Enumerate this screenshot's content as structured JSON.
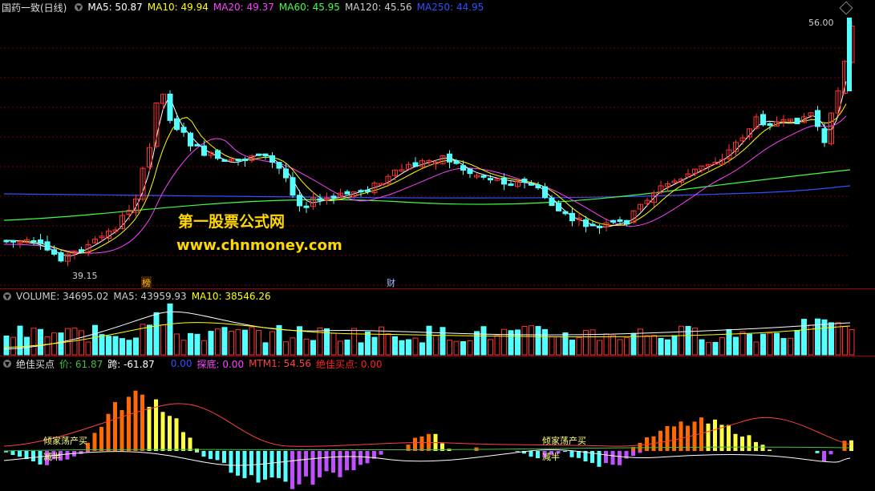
{
  "main": {
    "title": "国药一致(日线)",
    "ma_legend": [
      {
        "label": "MA5: 50.87",
        "color": "#ffffff"
      },
      {
        "label": "MA10: 49.94",
        "color": "#ffff00"
      },
      {
        "label": "MA20: 49.37",
        "color": "#ff40ff"
      },
      {
        "label": "MA60: 45.95",
        "color": "#40ff40"
      },
      {
        "label": "MA120: 45.56",
        "color": "#cccccc"
      },
      {
        "label": "MA250: 44.95",
        "color": "#3050ff"
      }
    ],
    "high_label": "56.00",
    "low_label": "39.15",
    "tag_bang": "榜",
    "tag_cai": "财",
    "watermark_cn": "第一股票公式网",
    "watermark_url": "www.chnmoney.com"
  },
  "volume": {
    "legend": [
      {
        "label": "VOLUME: 34695.02",
        "color": "#cccccc"
      },
      {
        "label": "MA5: 43959.93",
        "color": "#cccccc"
      },
      {
        "label": "MA10: 38546.26",
        "color": "#ffff00"
      }
    ]
  },
  "indicator": {
    "title": "绝佳买点",
    "legend": [
      {
        "label": "价: 61.87",
        "color": "#40c040"
      },
      {
        "label": "跨: -61.87",
        "color": "#ffffff"
      },
      {
        "label": "0.00",
        "color": "#3050ff"
      },
      {
        "label": "探底: 0.00",
        "color": "#ff40ff"
      },
      {
        "label": "MTM1: 54.56",
        "color": "#ff4040"
      },
      {
        "label": "绝佳买点: 0.00",
        "color": "#ff2020"
      }
    ],
    "annot_left_top": "倾家荡产买",
    "annot_left_bottom": "减半",
    "annot_right_top": "倾家荡产买",
    "annot_right_bottom": "减半"
  },
  "colors": {
    "up": "#ff3232",
    "down": "#54ffff",
    "grid": "#7a0000",
    "ma5": "#ffffff",
    "ma10": "#ffff00",
    "ma20": "#ff40ff",
    "ma60": "#40ff40",
    "ma250": "#3050ff",
    "bar_pos_big": "#ff6a00",
    "bar_pos_yellow": "#ffff40",
    "bar_neg_cyan": "#54ffff",
    "bar_neg_purple": "#c050ff"
  }
}
